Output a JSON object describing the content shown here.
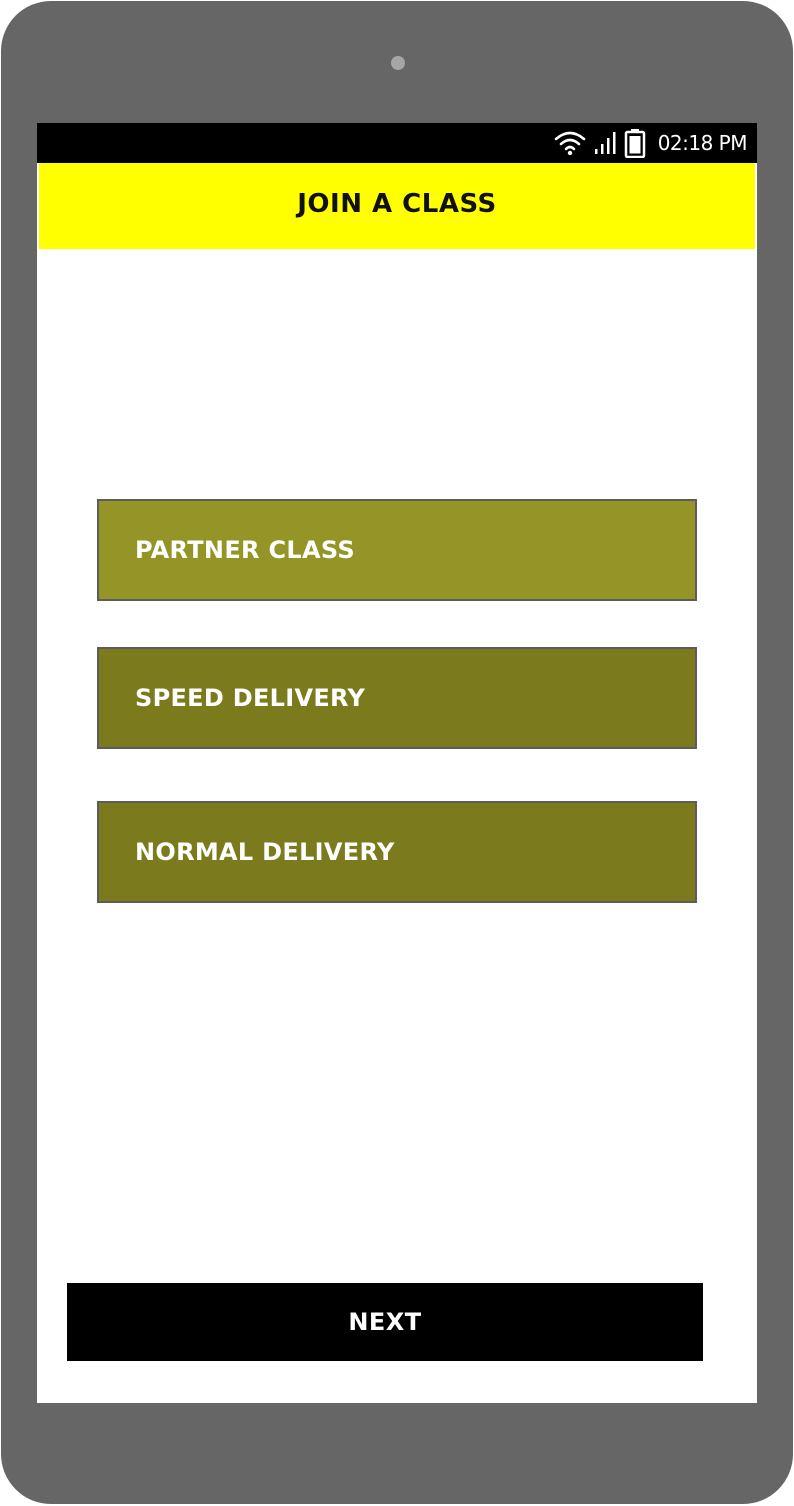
{
  "status_bar": {
    "time": "02:18 PM",
    "icons": [
      "wifi-icon",
      "signal-icon",
      "battery-icon"
    ]
  },
  "header": {
    "title": "JOIN A CLASS"
  },
  "options": [
    {
      "label": "PARTNER CLASS",
      "color": "#949427"
    },
    {
      "label": "SPEED DELIVERY",
      "color": "#7b7b1e"
    },
    {
      "label": "NORMAL DELIVERY",
      "color": "#7b7b1e"
    }
  ],
  "footer": {
    "next_label": "NEXT"
  },
  "colors": {
    "device_frame": "#666666",
    "app_bar": "#ffff00",
    "status_bar": "#000000",
    "next_button": "#000000"
  }
}
